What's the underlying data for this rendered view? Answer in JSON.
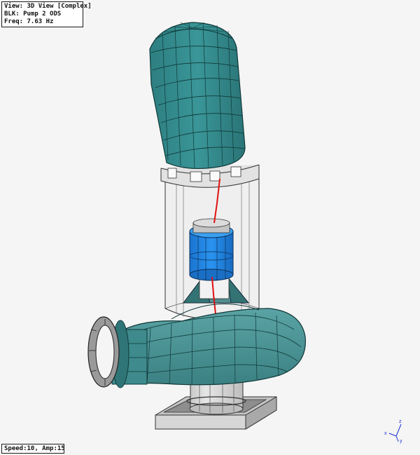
{
  "info": {
    "view": "View: 3D View [Complex]",
    "block": "BLK: Pump 2 ODS",
    "freq": "Freq: 7.63 Hz"
  },
  "status": {
    "speed_amp": "Speed:10, Amp:15"
  },
  "axes": {
    "x": "x",
    "y": "y",
    "z": "z"
  },
  "colors": {
    "motor": "#2f8585",
    "motor_line": "#103838",
    "casing": "#4a8f91",
    "coupling": "#1f85e6",
    "frame": "#d8d8d8",
    "shaft": "#e01010",
    "axis": "#1a2fd0"
  }
}
